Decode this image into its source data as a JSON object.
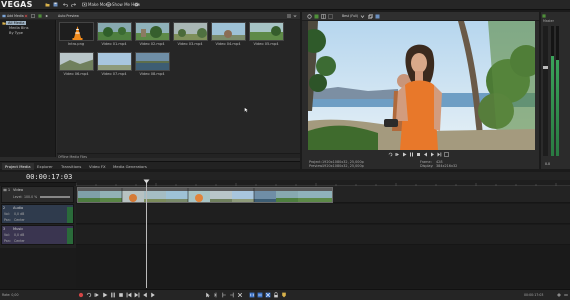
{
  "app": {
    "brand": "VEGAS"
  },
  "toolbar": {
    "make_movie": "Make Movie",
    "show_me_how": "Show Me How"
  },
  "project_media": {
    "toolbar": {
      "add_media": "Add Media",
      "auto_preview": "Auto Preview"
    },
    "tree": [
      "All Media",
      "Media Bins",
      "By Type"
    ],
    "items": [
      {
        "label": "Intro.png",
        "kind": "vlc"
      },
      {
        "label": "Video 01.mp4",
        "kind": "green"
      },
      {
        "label": "Video 02.mp4",
        "kind": "green2"
      },
      {
        "label": "Video 03.mp4",
        "kind": "field"
      },
      {
        "label": "Video 04.mp4",
        "kind": "sky"
      },
      {
        "label": "Video 05.mp4",
        "kind": "green"
      },
      {
        "label": "Video 06.mp4",
        "kind": "hill"
      },
      {
        "label": "Video 07.mp4",
        "kind": "sky"
      },
      {
        "label": "Video 08.mp4",
        "kind": "lake"
      }
    ],
    "status": "Offline Media Files"
  },
  "tabs": [
    "Project Media",
    "Explorer",
    "Transitions",
    "Video FX",
    "Media Generators"
  ],
  "preview": {
    "quality": "Best (Full)",
    "info": {
      "project_label": "Project:",
      "project_value": "1920x1080x32, 25,000p",
      "preview_label": "Preview:",
      "preview_value": "1920x1080x32, 25,000p",
      "frame_label": "Frame:",
      "frame_value": "428",
      "display_label": "Display:",
      "display_value": "384x216x32"
    }
  },
  "master": {
    "label": "Master",
    "value": "0.0"
  },
  "timeline": {
    "timecode": "00:00:17:03",
    "tracks": [
      {
        "name": "Video",
        "number": "1",
        "level_label": "Level:",
        "level": "100.0 %"
      },
      {
        "name": "Audio",
        "number": "2",
        "vol_label": "Vol:",
        "vol": "0,0 dB",
        "pan_label": "Pan:",
        "pan": "Center"
      },
      {
        "name": "Music",
        "number": "3",
        "vol_label": "Vol:",
        "vol": "0,0 dB",
        "pan_label": "Pan:",
        "pan": "Center"
      }
    ]
  },
  "bottom": {
    "rate": "Rate: 0,00",
    "time": "00:00:17:03"
  },
  "colors": {
    "accent": "#3b73c8",
    "audio_track": "#4a7ec0",
    "music_track": "#6b5a9a",
    "clip_blue": "#2c6bd1"
  }
}
